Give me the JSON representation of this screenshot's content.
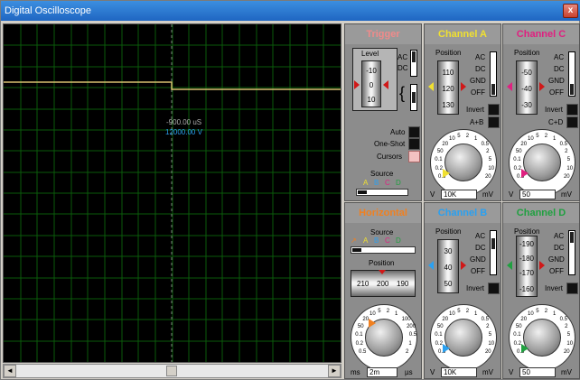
{
  "window": {
    "title": "Digital Oscilloscope",
    "close_label": "x"
  },
  "screen": {
    "cursor_time": "-900.00 uS",
    "cursor_voltage": "12000.00 V"
  },
  "scroll": {
    "left_arrow": "◄",
    "right_arrow": "►"
  },
  "trigger": {
    "title": "Trigger",
    "level_label": "Level",
    "ac": "AC",
    "dc": "DC",
    "drum": [
      "-10",
      "0",
      "10"
    ],
    "auto": "Auto",
    "one_shot": "One-Shot",
    "cursors": "Cursors",
    "source_label": "Source",
    "sources": [
      "A",
      "B",
      "C",
      "D"
    ]
  },
  "channel_a": {
    "title": "Channel A",
    "position_label": "Position",
    "drum": [
      "110",
      "120",
      "130"
    ],
    "ac": "AC",
    "dc": "DC",
    "gnd": "GND",
    "off": "OFF",
    "invert": "Invert",
    "aplusb": "A+B",
    "field": "10K",
    "unit_left": "V",
    "unit_right": "mV",
    "dial": [
      "0.5",
      "0.2",
      "0.1",
      "50",
      "20",
      "10",
      "5",
      "2",
      "1",
      "0.5",
      "2",
      "5",
      "10",
      "20"
    ]
  },
  "channel_c": {
    "title": "Channel C",
    "position_label": "Position",
    "drum": [
      "-50",
      "-40",
      "-30"
    ],
    "ac": "AC",
    "dc": "DC",
    "gnd": "GND",
    "off": "OFF",
    "invert": "Invert",
    "cplusd": "C+D",
    "field": "50",
    "unit_left": "V",
    "unit_right": "mV",
    "dial": [
      "0.5",
      "0.2",
      "0.1",
      "50",
      "20",
      "10",
      "5",
      "2",
      "1",
      "0.5",
      "2",
      "5",
      "10",
      "20"
    ]
  },
  "horizontal": {
    "title": "Horizontal",
    "source_label": "Source",
    "sources": [
      "A",
      "B",
      "C",
      "D"
    ],
    "position_label": "Position",
    "drum": [
      "210",
      "200",
      "190"
    ],
    "field": "2m",
    "unit_left": "ms",
    "unit_right": "µs",
    "dial": [
      "0.5",
      "0.2",
      "0.1",
      "50",
      "20",
      "10",
      "5",
      "2",
      "1",
      "100",
      "200",
      "0.5",
      "1",
      "2"
    ]
  },
  "channel_b": {
    "title": "Channel B",
    "position_label": "Position",
    "drum": [
      "30",
      "40",
      "50"
    ],
    "ac": "AC",
    "dc": "DC",
    "gnd": "GND",
    "off": "OFF",
    "invert": "Invert",
    "field": "10K",
    "unit_left": "V",
    "unit_right": "mV",
    "dial": [
      "0.5",
      "0.2",
      "0.1",
      "50",
      "20",
      "10",
      "5",
      "2",
      "1",
      "0.5",
      "2",
      "5",
      "10",
      "20"
    ]
  },
  "channel_d": {
    "title": "Channel D",
    "position_label": "Position",
    "drum": [
      "-190",
      "-180",
      "-170",
      "-160"
    ],
    "ac": "AC",
    "dc": "DC",
    "gnd": "GND",
    "off": "OFF",
    "invert": "Invert",
    "field": "50",
    "unit_left": "V",
    "unit_right": "mV",
    "dial": [
      "0.5",
      "0.2",
      "0.1",
      "50",
      "20",
      "10",
      "5",
      "2",
      "1",
      "0.5",
      "2",
      "5",
      "10",
      "20"
    ]
  },
  "colors": {
    "trigger": "#f08a8a",
    "channel_a": "#f0e030",
    "channel_b": "#2aa0f0",
    "channel_c": "#e02080",
    "channel_d": "#20a040",
    "horizontal": "#f08020",
    "trace": "#d8c070",
    "grid": "#0a5a0a"
  }
}
